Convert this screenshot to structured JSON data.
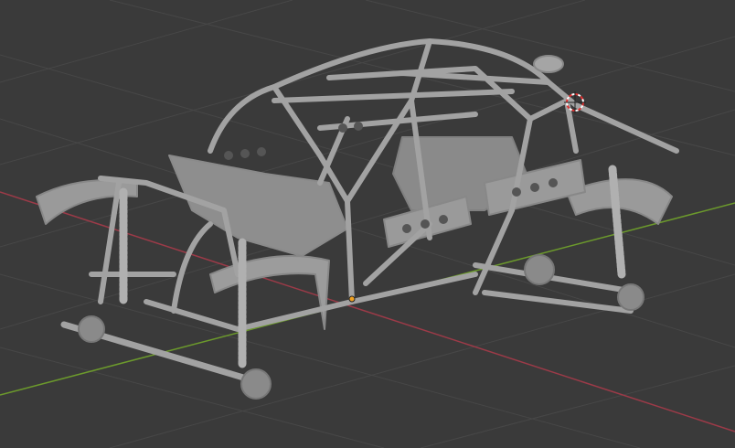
{
  "viewport": {
    "mode": "3d-viewport",
    "background_color": "#3a3a3a",
    "grid_color": "#474747",
    "x_axis_color": "#9c3a48",
    "y_axis_color": "#6c9a2c",
    "model_color": "#9a9a9a",
    "model_shadow_color": "#6e6e6e"
  },
  "objects": {
    "model": "rally-truck-chassis",
    "cursor_icon": "3d-cursor-icon",
    "origin_icon": "object-origin-icon",
    "origin_color": "#f0a020"
  }
}
